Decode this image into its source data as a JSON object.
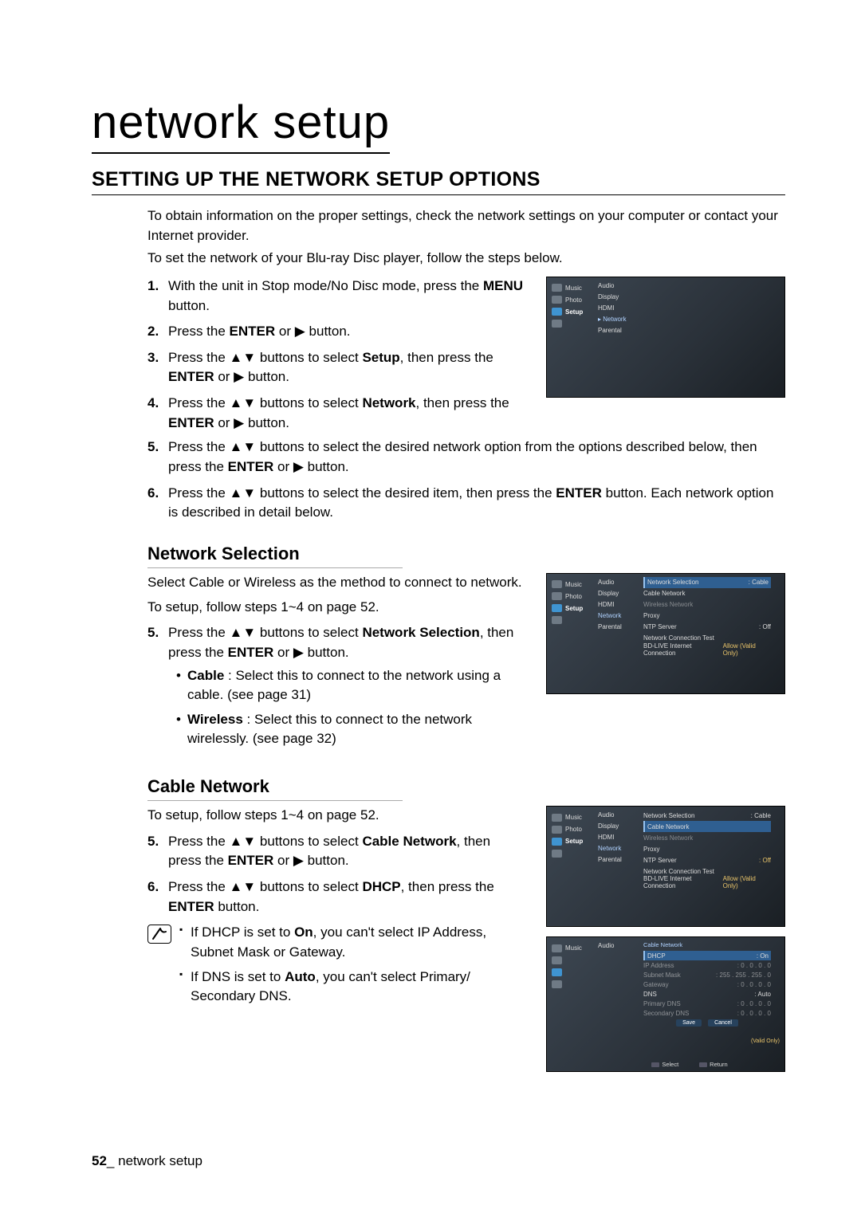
{
  "pageTitle": "network setup",
  "sectionTitle": "SETTING UP THE NETWORK SETUP OPTIONS",
  "intro1": "To obtain information on the proper settings, check the network settings on your computer or contact your Internet provider.",
  "intro2": "To set the network of your Blu-ray Disc player, follow the steps below.",
  "steps_main": [
    "With the unit in Stop mode/No Disc mode, press the MENU button.",
    "Press the ENTER or ▶ button.",
    "Press the ▲▼ buttons to select Setup, then press the ENTER or ▶ button.",
    "Press the ▲▼ buttons to select Network, then press the ENTER or ▶ button.",
    "Press the ▲▼ buttons to select the desired network option from the options described below, then press the ENTER or ▶ button.",
    "Press the ▲▼ buttons to select the desired item, then press the ENTER button. Each network option is described in detail below."
  ],
  "sub_ns": {
    "title": "Network Selection",
    "p1": "Select Cable or Wireless as the method to connect to network.",
    "p2": "To setup, follow steps 1~4 on page 52.",
    "step5": "Press the ▲▼ buttons to select Network Selection, then press the ENTER or ▶ button.",
    "b1": "Cable : Select this to connect to the network using a cable. (see page 31)",
    "b2": "Wireless : Select this to connect to the network wirelessly. (see page 32)"
  },
  "sub_cn": {
    "title": "Cable Network",
    "p1": "To setup, follow steps 1~4 on page 52.",
    "step5": "Press the ▲▼ buttons to select Cable Network, then press the ENTER or ▶ button.",
    "step6": "Press the ▲▼ buttons to select DHCP, then press the ENTER button.",
    "n1": "If DHCP is set to On, you can't select IP Address, Subnet Mask or Gateway.",
    "n2": "If DNS is set to Auto, you can't select Primary/ Secondary DNS."
  },
  "tv_left": {
    "music": "Music",
    "photo": "Photo",
    "setup": "Setup"
  },
  "tv1": {
    "mid": [
      "Audio",
      "Display",
      "HDMI",
      "▸ Network",
      "Parental"
    ]
  },
  "tv2": {
    "mid": [
      "Audio",
      "Display",
      "HDMI",
      "Network",
      "Parental"
    ],
    "right": [
      {
        "l": "Network Selection",
        "r": ": Cable",
        "sel": true
      },
      {
        "l": "Cable Network",
        "r": ""
      },
      {
        "l": "Wireless Network",
        "r": ""
      },
      {
        "l": "Proxy",
        "r": ""
      },
      {
        "l": "NTP Server",
        "r": ": Off"
      },
      {
        "l": "Network Connection Test",
        "r": ""
      },
      {
        "l": "BD-LIVE Internet Connection",
        "r": "Allow (Valid Only)"
      }
    ]
  },
  "tv3": {
    "mid": [
      "Audio",
      "Display",
      "HDMI",
      "Network",
      "Parental"
    ],
    "right": [
      {
        "l": "Network Selection",
        "r": ": Cable"
      },
      {
        "l": "Cable Network",
        "r": "",
        "sel": true
      },
      {
        "l": "Wireless Network",
        "r": ""
      },
      {
        "l": "Proxy",
        "r": ""
      },
      {
        "l": "NTP Server",
        "r": ": Off"
      },
      {
        "l": "Network Connection Test",
        "r": ""
      },
      {
        "l": "BD-LIVE Internet Connection",
        "r": "Allow (Valid Only)"
      }
    ]
  },
  "tv4": {
    "mid": [
      "Audio"
    ],
    "title": "Cable Network",
    "rows": [
      {
        "l": "DHCP",
        "r": ": On",
        "sel": true
      },
      {
        "l": "IP Address",
        "r": ": 0 . 0 . 0 . 0"
      },
      {
        "l": "Subnet Mask",
        "r": ": 255 . 255 . 255 . 0"
      },
      {
        "l": "Gateway",
        "r": ": 0 . 0 . 0 . 0"
      },
      {
        "l": "DNS",
        "r": ": Auto"
      },
      {
        "l": "Primary DNS",
        "r": ": 0 . 0 . 0 . 0"
      },
      {
        "l": "Secondary DNS",
        "r": ": 0 . 0 . 0 . 0"
      }
    ],
    "btn_save": "Save",
    "btn_cancel": "Cancel",
    "foot_select": "Select",
    "foot_return": "Return",
    "side": "(Valid Only)"
  },
  "footer": {
    "num": "52",
    "sep": "_",
    "text": " network setup"
  }
}
